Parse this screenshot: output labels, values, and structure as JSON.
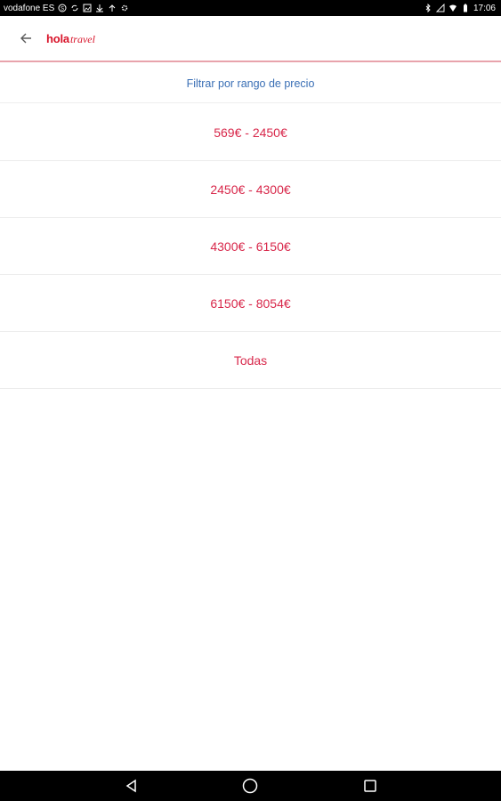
{
  "status_bar": {
    "carrier": "vodafone ES",
    "time": "17:06",
    "left_icons": [
      "skype-icon",
      "sync-icon",
      "image-icon",
      "download-icon",
      "upload-icon",
      "settings-icon"
    ],
    "right_icons": [
      "bluetooth-icon",
      "signal-off-icon",
      "wifi-icon",
      "battery-icon"
    ]
  },
  "app_bar": {
    "logo_part1": "hola",
    "logo_part2": "travel",
    "accent_color": "#d8142a"
  },
  "filter": {
    "title": "Filtrar por rango de precio",
    "title_color": "#3a6fb5",
    "options": [
      {
        "label": "569€ - 2450€"
      },
      {
        "label": "2450€ - 4300€"
      },
      {
        "label": "4300€ - 6150€"
      },
      {
        "label": "6150€ - 8054€"
      },
      {
        "label": "Todas"
      }
    ],
    "option_color": "#d8274a"
  },
  "navigation": {
    "buttons": [
      "back-triangle-icon",
      "home-circle-icon",
      "recents-square-icon"
    ]
  }
}
